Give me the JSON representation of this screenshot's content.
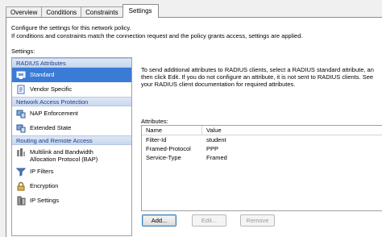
{
  "tabs": [
    "Overview",
    "Conditions",
    "Constraints",
    "Settings"
  ],
  "intro": {
    "line1": "Configure the settings for this network policy.",
    "line2": "If conditions and constraints match the connection request and the policy grants access, settings are applied."
  },
  "settings_label": "Settings:",
  "tree": {
    "radius_header": "RADIUS Attributes",
    "standard": "Standard",
    "vendor_specific": "Vendor Specific",
    "nap_header": "Network Access Protection",
    "nap_enforcement": "NAP Enforcement",
    "extended_state": "Extended State",
    "routing_header": "Routing and Remote Access",
    "multilink_line1": "Multilink and Bandwidth",
    "multilink_line2": "Allocation Protocol (BAP)",
    "ip_filters": "IP Filters",
    "encryption": "Encryption",
    "ip_settings": "IP Settings"
  },
  "description": {
    "line1": "To send additional attributes to RADIUS clients, select a RADIUS standard attribute, an",
    "line2": "then click Edit. If you do not configure an attribute, it is not sent to RADIUS clients. See",
    "line3": "your RADIUS client documentation for required attributes."
  },
  "attributes": {
    "label": "Attributes:",
    "col_name": "Name",
    "col_value": "Value",
    "rows": [
      {
        "name": "Filter-Id",
        "value": "student"
      },
      {
        "name": "Framed-Protocol",
        "value": "PPP"
      },
      {
        "name": "Service-Type",
        "value": "Framed"
      }
    ]
  },
  "buttons": {
    "add": "Add...",
    "edit": "Edit...",
    "remove": "Remove"
  },
  "colors": {
    "selected": "#3a7bd5",
    "category_text": "#1a3f8a"
  }
}
